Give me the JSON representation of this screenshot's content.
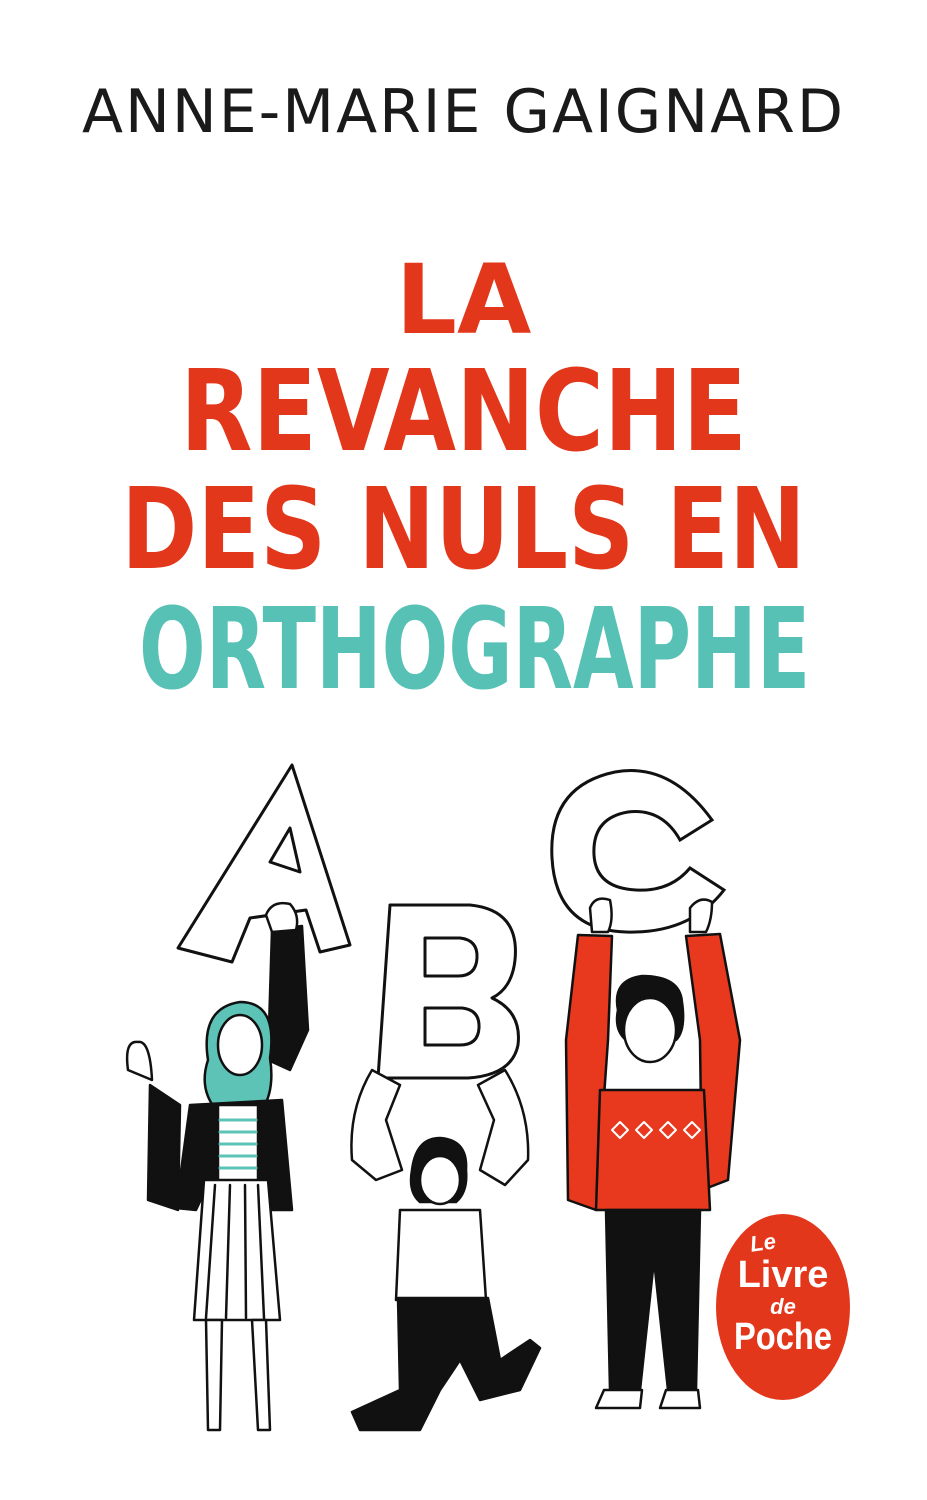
{
  "cover": {
    "author": "ANNE-MARIE GAIGNARD",
    "title_lines": [
      "LA",
      "REVANCHE",
      "DES NULS EN",
      "ORTHOGRAPHE"
    ],
    "illustration_letters": [
      "A",
      "B",
      "C"
    ],
    "publisher_logo": {
      "line1": "Le",
      "line2": "Livre",
      "line3": "de",
      "line4": "Poche"
    }
  },
  "colors": {
    "title_red": "#e3371c",
    "title_teal": "#56c1b4",
    "author_text": "#1a1a1a",
    "background": "#ffffff",
    "hair_teal": "#5cc3b6",
    "sweater_red": "#e8391e",
    "clothing_black": "#111111"
  },
  "icons": [
    "livre-de-poche-logo"
  ]
}
